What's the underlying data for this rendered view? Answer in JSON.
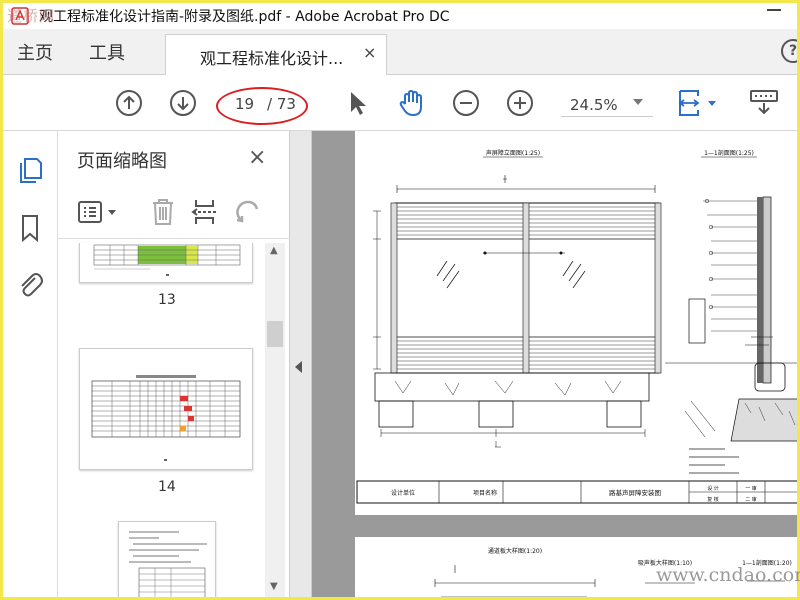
{
  "window": {
    "title": "观工程标准化设计指南-附录及图纸.pdf - Adobe Acrobat Pro DC",
    "watermark_top": "道桥网",
    "watermark_bottom": "www.cndao.com"
  },
  "tabs": {
    "home": "主页",
    "tools": "工具",
    "document": "观工程标准化设计...",
    "close_glyph": "×",
    "help_glyph": "?"
  },
  "toolbar": {
    "page_current": "19",
    "page_total": "/ 73",
    "zoom": "24.5%"
  },
  "thumbnails": {
    "panel_title": "页面缩略图",
    "close_glyph": "×",
    "pages": [
      {
        "number": "13"
      },
      {
        "number": "14"
      }
    ]
  },
  "drawing": {
    "title_elevation": "声屏障立面图(1:25)",
    "title_section": "1—1剖面图(1:25)",
    "title_block": [
      "设计单位",
      "项目名称",
      "路基声屏障安装图",
      "设 计",
      "复 核",
      "一 审",
      "二 审"
    ],
    "next_titles": [
      "通道板大样图(1:20)",
      "吸声板大样图(1:10)",
      "1—1剖面图(1:20)"
    ]
  },
  "colors": {
    "highlight_frame": "#f2e84b",
    "annotation_red": "#d92020",
    "accent_blue": "#2b6fc9"
  }
}
